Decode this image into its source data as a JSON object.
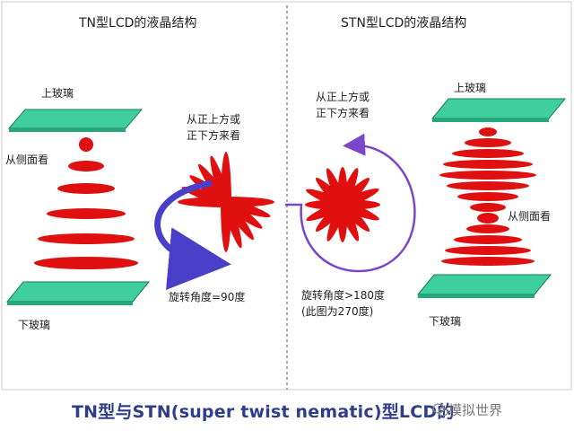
{
  "left_panel": {
    "title": "TN型LCD的液晶结构",
    "top_glass": "上玻璃",
    "bottom_glass": "下玻璃",
    "side_view": "从侧面看",
    "top_view_line1": "从正上方或",
    "top_view_line2": "正下方来看",
    "rotation": "旋转角度=90度"
  },
  "right_panel": {
    "title": "STN型LCD的液晶结构",
    "top_glass": "上玻璃",
    "bottom_glass": "下玻璃",
    "side_view": "从侧面看",
    "top_view_line1": "从正上方或",
    "top_view_line2": "正下方来看",
    "rotation_line1": "旋转角度>180度",
    "rotation_line2": "(此图为270度)"
  },
  "caption": "TN型与STN(super twist nematic)型LCD的",
  "watermark": "模拟世界",
  "colors": {
    "glass": "#3fcf9f",
    "crystal": "#e01010",
    "arrow_left": "#4a3fc8",
    "arrow_right": "#7b46c9",
    "caption": "#2e3d8c"
  }
}
